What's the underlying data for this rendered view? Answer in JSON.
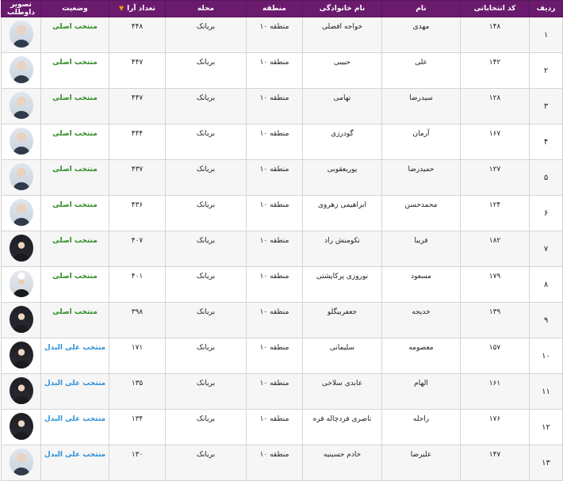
{
  "headers": {
    "row": "ردیف",
    "code": "کد انتخاباتی",
    "first_name": "نام",
    "last_name": "نام خانوادگی",
    "region": "منطقه",
    "neighborhood": "محله",
    "votes": "تعداد آرا",
    "status": "وضعیت",
    "photo": "تصویر داوطلب"
  },
  "sort_icon": "sort-down-arrow",
  "colors": {
    "header_bg": "#6a1b6e",
    "status_main": "#2e8b24",
    "status_alt": "#2f8fd6"
  },
  "rows": [
    {
      "row": "۱",
      "code": "۱۴۸",
      "first_name": "مهدی",
      "last_name": "خواجه افضلی",
      "region": "منطقه ۱۰",
      "neighborhood": "بریانک",
      "votes": "۴۴۸",
      "status": "منتخب اصلی",
      "status_type": "main",
      "photo": "male"
    },
    {
      "row": "۲",
      "code": "۱۴۲",
      "first_name": "علی",
      "last_name": "حبیبی",
      "region": "منطقه ۱۰",
      "neighborhood": "بریانک",
      "votes": "۴۴۷",
      "status": "منتخب اصلی",
      "status_type": "main",
      "photo": "male"
    },
    {
      "row": "۳",
      "code": "۱۲۸",
      "first_name": "سیدرضا",
      "last_name": "تهامی",
      "region": "منطقه ۱۰",
      "neighborhood": "بریانک",
      "votes": "۴۴۷",
      "status": "منتخب اصلی",
      "status_type": "main",
      "photo": "male"
    },
    {
      "row": "۴",
      "code": "۱۶۷",
      "first_name": "آرمان",
      "last_name": "گودرزی",
      "region": "منطقه ۱۰",
      "neighborhood": "بریانک",
      "votes": "۴۴۴",
      "status": "منتخب اصلی",
      "status_type": "main",
      "photo": "male"
    },
    {
      "row": "۵",
      "code": "۱۲۷",
      "first_name": "حمیدرضا",
      "last_name": "پوریعقوبی",
      "region": "منطقه ۱۰",
      "neighborhood": "بریانک",
      "votes": "۴۳۷",
      "status": "منتخب اصلی",
      "status_type": "main",
      "photo": "male"
    },
    {
      "row": "۶",
      "code": "۱۲۴",
      "first_name": "محمدحسن",
      "last_name": "ابراهیمی زهروی",
      "region": "منطقه ۱۰",
      "neighborhood": "بریانک",
      "votes": "۴۳۶",
      "status": "منتخب اصلی",
      "status_type": "main",
      "photo": "male"
    },
    {
      "row": "۷",
      "code": "۱۸۲",
      "first_name": "فریبا",
      "last_name": "نکومنش راد",
      "region": "منطقه ۱۰",
      "neighborhood": "بریانک",
      "votes": "۴۰۷",
      "status": "منتخب اصلی",
      "status_type": "main",
      "photo": "female"
    },
    {
      "row": "۸",
      "code": "۱۷۹",
      "first_name": "مسعود",
      "last_name": "نوروزی پرکاپشتی",
      "region": "منطقه ۱۰",
      "neighborhood": "بریانک",
      "votes": "۴۰۱",
      "status": "منتخب اصلی",
      "status_type": "main",
      "photo": "cleric"
    },
    {
      "row": "۹",
      "code": "۱۳۹",
      "first_name": "خدیجه",
      "last_name": "جعفربیگلو",
      "region": "منطقه ۱۰",
      "neighborhood": "بریانک",
      "votes": "۳۹۸",
      "status": "منتخب اصلی",
      "status_type": "main",
      "photo": "female"
    },
    {
      "row": "۱۰",
      "code": "۱۵۷",
      "first_name": "معصومه",
      "last_name": "سلیمانی",
      "region": "منطقه ۱۰",
      "neighborhood": "بریانک",
      "votes": "۱۷۱",
      "status": "منتخب علی البدل",
      "status_type": "alt",
      "photo": "female"
    },
    {
      "row": "۱۱",
      "code": "۱۶۱",
      "first_name": "الهام",
      "last_name": "عابدی سلاخی",
      "region": "منطقه ۱۰",
      "neighborhood": "بریانک",
      "votes": "۱۳۵",
      "status": "منتخب علی البدل",
      "status_type": "alt",
      "photo": "female"
    },
    {
      "row": "۱۲",
      "code": "۱۷۶",
      "first_name": "راحله",
      "last_name": "ناصری فردچاله قره",
      "region": "منطقه ۱۰",
      "neighborhood": "بریانک",
      "votes": "۱۳۴",
      "status": "منتخب علی البدل",
      "status_type": "alt",
      "photo": "female"
    },
    {
      "row": "۱۳",
      "code": "۱۴۷",
      "first_name": "علیرضا",
      "last_name": "خادم حسینیه",
      "region": "منطقه ۱۰",
      "neighborhood": "بریانک",
      "votes": "۱۳۰",
      "status": "منتخب علی البدل",
      "status_type": "alt",
      "photo": "male"
    }
  ]
}
